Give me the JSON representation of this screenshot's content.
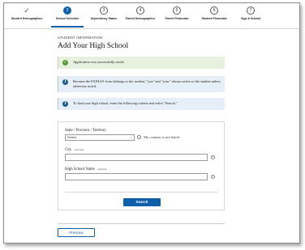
{
  "stepper": {
    "steps": [
      {
        "number": "",
        "label": "Student Demographics",
        "state": "complete"
      },
      {
        "number": "2",
        "label": "School Selection",
        "state": "current"
      },
      {
        "number": "3",
        "label": "Dependency Status",
        "state": "todo"
      },
      {
        "number": "4",
        "label": "Parent Demographics",
        "state": "todo"
      },
      {
        "number": "5",
        "label": "Parent Financials",
        "state": "todo"
      },
      {
        "number": "6",
        "label": "Student Financials",
        "state": "todo"
      },
      {
        "number": "7",
        "label": "Sign & Submit",
        "state": "todo"
      }
    ],
    "check_glyph": "✓"
  },
  "page": {
    "eyebrow": "STUDENT INFORMATION",
    "title": "Add Your High School"
  },
  "alerts": {
    "saved": {
      "icon": "check-circle-icon",
      "text": "Application was successfully saved."
    },
    "ownership": {
      "icon": "info-icon",
      "text": "Because the FAFSA® form belongs to the student, \"you\" and \"your\" always refers to the student unless otherwise noted."
    },
    "instructions": {
      "icon": "info-icon",
      "text": "To find your high school, enter the following criteria and select \"Search.\""
    }
  },
  "form": {
    "state_label": "State / Province / Territory",
    "state_value": "Select",
    "country_not_listed": "My country is not listed",
    "city_label": "City",
    "city_optional": "- optional",
    "city_value": "",
    "school_label": "High School Name",
    "school_optional": "- optional",
    "school_value": "",
    "search_label": "Search"
  },
  "nav": {
    "previous_label": "Previous"
  },
  "colors": {
    "primary": "#0f5ea8",
    "success_bg": "#e6f1e0",
    "success_icon": "#5a9a3a",
    "info_bg": "#e6eff7",
    "info_icon": "#1f5d96"
  }
}
